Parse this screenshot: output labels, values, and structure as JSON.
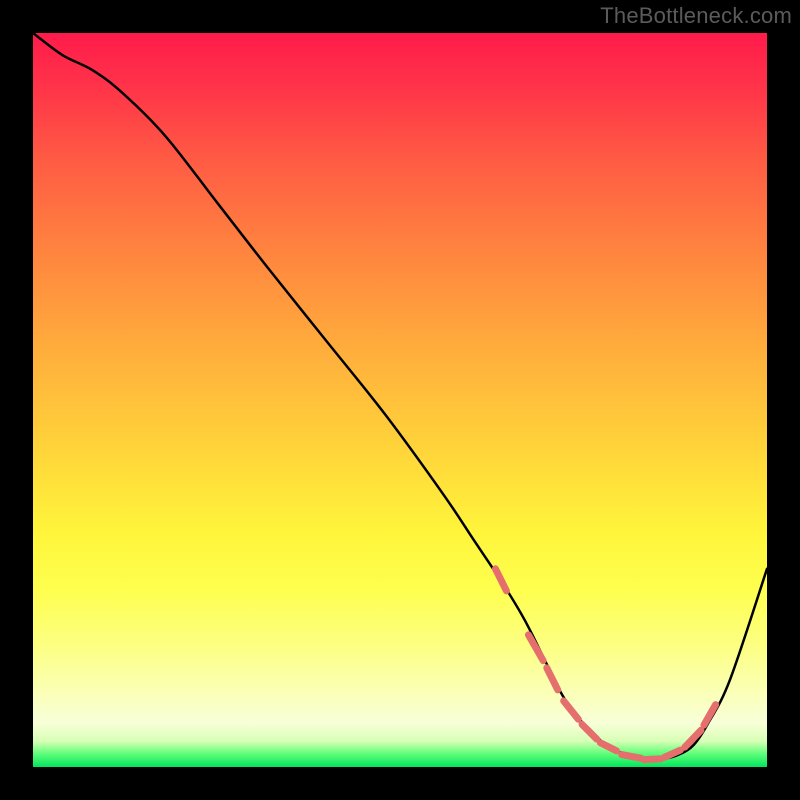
{
  "watermark": "TheBottleneck.com",
  "chart_data": {
    "type": "line",
    "title": "",
    "xlabel": "",
    "ylabel": "",
    "xlim": [
      0,
      100
    ],
    "ylim": [
      0,
      100
    ],
    "curve": {
      "name": "bottleneck-curve",
      "x": [
        0,
        4,
        8,
        12,
        18,
        25,
        32,
        40,
        48,
        56,
        60,
        64,
        67,
        70,
        72,
        74,
        76,
        78,
        80,
        82,
        84,
        86,
        88,
        90,
        92,
        95,
        100
      ],
      "y": [
        100,
        97,
        95,
        92,
        86,
        77,
        68,
        58,
        48,
        37,
        31,
        25,
        20,
        14,
        10,
        7,
        5,
        3,
        2,
        1.2,
        1,
        1.1,
        1.7,
        3,
        6,
        12,
        27
      ]
    },
    "dash_segments": [
      {
        "x0": 63,
        "y0": 27,
        "x1": 64.5,
        "y1": 24
      },
      {
        "x0": 67.5,
        "y0": 18,
        "x1": 69.5,
        "y1": 14.5
      },
      {
        "x0": 70,
        "y0": 13.5,
        "x1": 71.5,
        "y1": 10.5
      },
      {
        "x0": 72.3,
        "y0": 9,
        "x1": 74.3,
        "y1": 6.5
      },
      {
        "x0": 74.8,
        "y0": 5.8,
        "x1": 76.8,
        "y1": 3.8
      },
      {
        "x0": 77.3,
        "y0": 3.3,
        "x1": 79.5,
        "y1": 2.2
      },
      {
        "x0": 80.2,
        "y0": 1.7,
        "x1": 82.8,
        "y1": 1.2
      },
      {
        "x0": 83.2,
        "y0": 1.0,
        "x1": 85.5,
        "y1": 1.1
      },
      {
        "x0": 86.0,
        "y0": 1.3,
        "x1": 88.2,
        "y1": 2.3
      },
      {
        "x0": 88.8,
        "y0": 2.7,
        "x1": 91.0,
        "y1": 5.0
      },
      {
        "x0": 91.4,
        "y0": 5.7,
        "x1": 93.0,
        "y1": 8.5
      }
    ],
    "colors": {
      "curve": "#000000",
      "dash": "#e46f6c",
      "gradient_top": "#ff1b4b",
      "gradient_bottom": "#00e65c"
    }
  }
}
